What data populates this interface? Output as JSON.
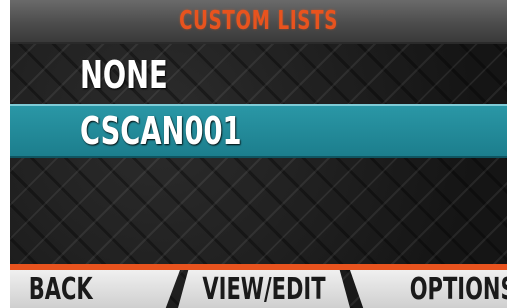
{
  "header": {
    "title": "CUSTOM LISTS"
  },
  "list": {
    "items": [
      {
        "label": "NONE",
        "selected": false
      },
      {
        "label": "CSCAN001",
        "selected": true
      }
    ]
  },
  "softkeys": {
    "back": "BACK",
    "view_edit": "VIEW/EDIT",
    "options": "OPTIONS"
  },
  "colors": {
    "title": "#e8531e",
    "selection": "#1f8a99",
    "accent_line": "#e8531e"
  }
}
